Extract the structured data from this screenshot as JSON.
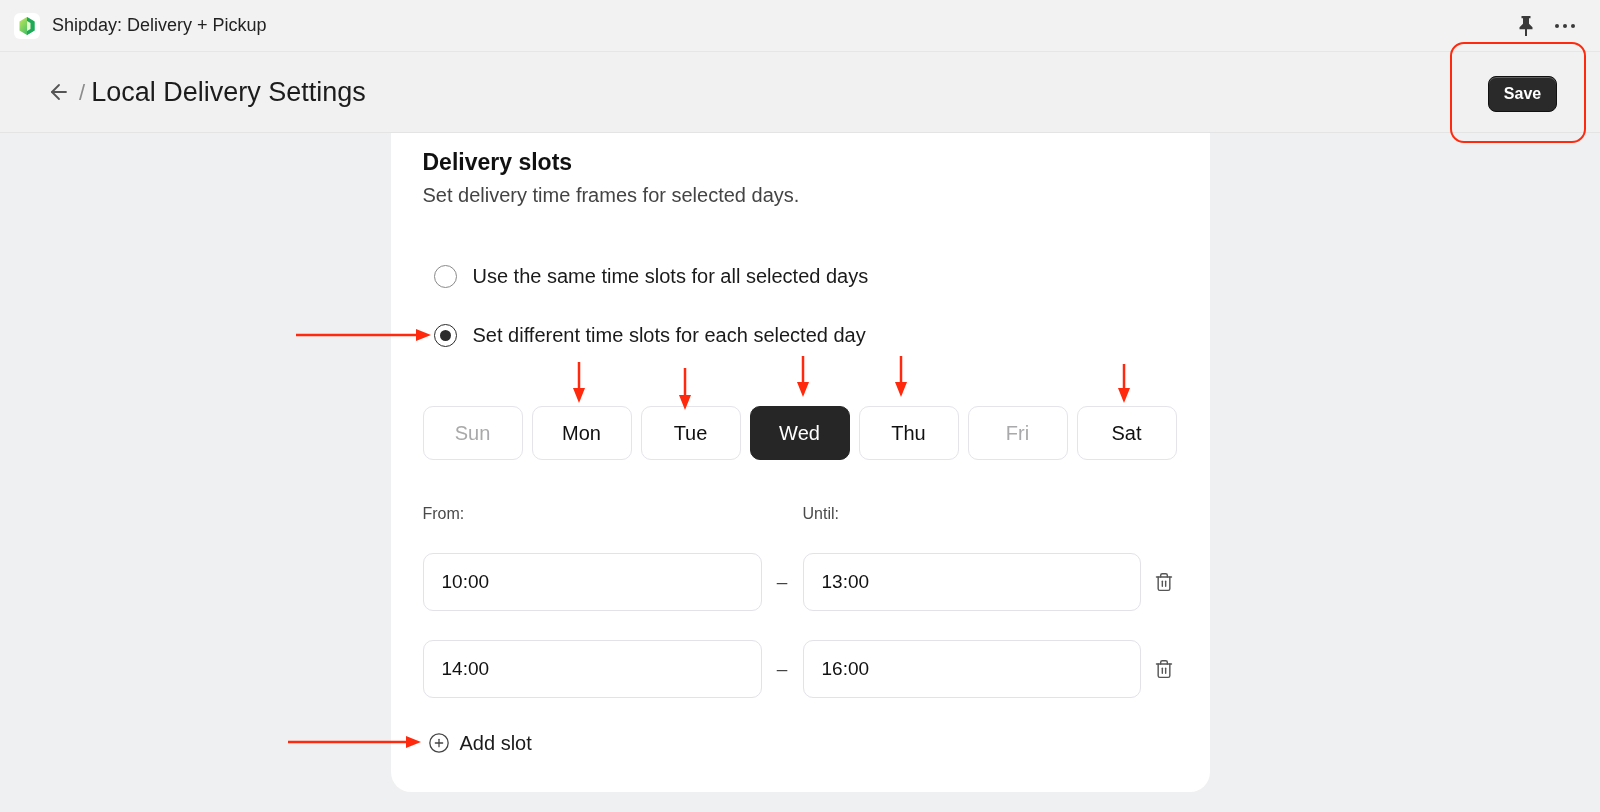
{
  "title_bar": {
    "app_name": "Shipday: Delivery + Pickup"
  },
  "header": {
    "separator": "/",
    "title": "Local Delivery Settings",
    "save_button": "Save"
  },
  "delivery_slots": {
    "title": "Delivery slots",
    "subtitle": "Set delivery time frames for selected days.",
    "options": [
      {
        "label": "Use the same time slots for all selected days",
        "selected": false
      },
      {
        "label": "Set different time slots for each selected day",
        "selected": true
      }
    ],
    "days": [
      {
        "label": "Sun",
        "selected": false,
        "disabled": true
      },
      {
        "label": "Mon",
        "selected": false,
        "disabled": false
      },
      {
        "label": "Tue",
        "selected": false,
        "disabled": false
      },
      {
        "label": "Wed",
        "selected": true,
        "disabled": false
      },
      {
        "label": "Thu",
        "selected": false,
        "disabled": false
      },
      {
        "label": "Fri",
        "selected": false,
        "disabled": true
      },
      {
        "label": "Sat",
        "selected": false,
        "disabled": false
      }
    ],
    "from_label": "From:",
    "until_label": "Until:",
    "slots": [
      {
        "from": "10:00",
        "separator": "–",
        "until": "13:00"
      },
      {
        "from": "14:00",
        "separator": "–",
        "until": "16:00"
      }
    ],
    "add_button": "Add slot"
  }
}
